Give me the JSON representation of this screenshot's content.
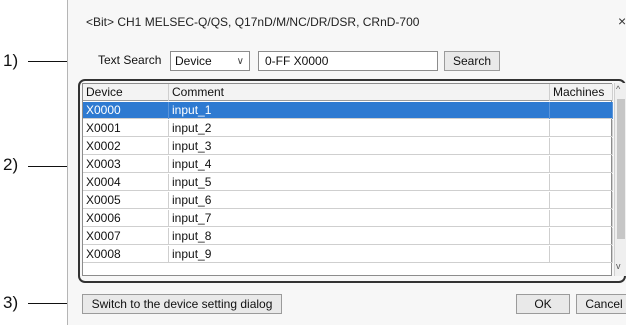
{
  "callouts": [
    "1)",
    "2)",
    "3)"
  ],
  "window": {
    "title": "<Bit> CH1 MELSEC-Q/QS, Q17nD/M/NC/DR/DSR, CRnD-700",
    "close_glyph": "×"
  },
  "search": {
    "label": "Text Search",
    "category_value": "Device",
    "caret": "∨",
    "query_value": "0-FF X0000",
    "button_label": "Search"
  },
  "table": {
    "headers": [
      "Device",
      "Comment",
      "Machines"
    ],
    "rows": [
      {
        "device": "X0000",
        "comment": "input_1",
        "machines": ""
      },
      {
        "device": "X0001",
        "comment": "input_2",
        "machines": ""
      },
      {
        "device": "X0002",
        "comment": "input_3",
        "machines": ""
      },
      {
        "device": "X0003",
        "comment": "input_4",
        "machines": ""
      },
      {
        "device": "X0004",
        "comment": "input_5",
        "machines": ""
      },
      {
        "device": "X0005",
        "comment": "input_6",
        "machines": ""
      },
      {
        "device": "X0006",
        "comment": "input_7",
        "machines": ""
      },
      {
        "device": "X0007",
        "comment": "input_8",
        "machines": ""
      },
      {
        "device": "X0008",
        "comment": "input_9",
        "machines": ""
      }
    ],
    "selected_index": 0
  },
  "scroll": {
    "up_glyph": "^",
    "down_glyph": "v"
  },
  "footer": {
    "switch_label": "Switch to the device setting dialog",
    "ok_label": "OK",
    "cancel_label": "Cancel"
  },
  "colors": {
    "selection": "#2e7ad1",
    "group_border": "#333333"
  }
}
